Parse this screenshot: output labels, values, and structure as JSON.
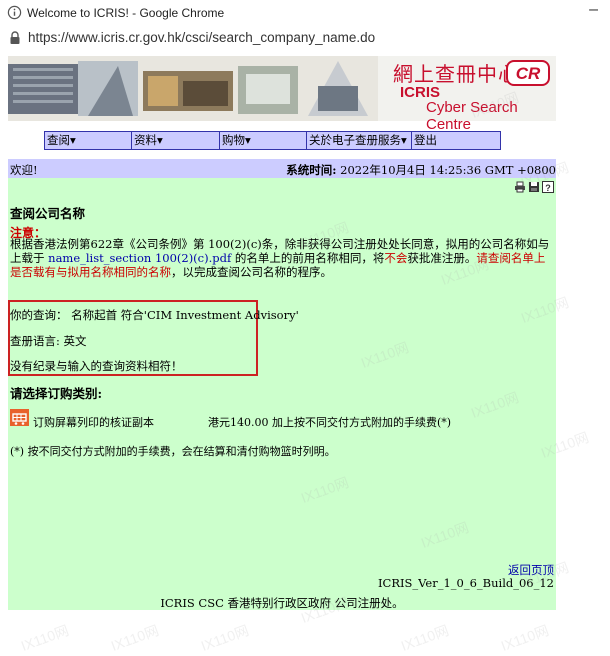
{
  "browser": {
    "window_title": "Welcome to ICRIS! - Google Chrome",
    "minimize_glyph": "–",
    "url": "https://www.icris.cr.gov.hk/csci/search_company_name.do"
  },
  "banner": {
    "chinese_title": "網上查冊中心",
    "icris": "ICRIS",
    "subtitle": "Cyber Search Centre",
    "logo_text": "CR"
  },
  "menu": {
    "items": [
      {
        "label": "查阅▾"
      },
      {
        "label": "资料▾"
      },
      {
        "label": "购物▾"
      },
      {
        "label": "关於电子查册服务▾"
      },
      {
        "label": "登出"
      }
    ]
  },
  "greeting": {
    "welcome": "欢迎!",
    "system_time_label": "系统时间:",
    "system_time_value": "2022年10月4日 14:25:36 GMT +0800"
  },
  "page": {
    "title": "查阅公司名称",
    "note_label": "注意：",
    "note_para_1": "根据香港法例第622章《公司条例》第 100(2)(c)条，除非获得公司注册处处长同意，拟用的公司名称如与上载于 ",
    "note_link": "name_list_section 100(2)(c).pdf",
    "note_para_2": " 的名单上的前用名称相同，将",
    "note_not": "不会",
    "note_para_3": "获批准注册。",
    "note_red": "请查阅名单上是否载有与拟用名称相同的名称",
    "note_para_4": "，以完成查阅公司名称的程序。",
    "query_line": "你的查询： 名称起首 符合'CIM Investment Advisory'",
    "language_line": "查册语言: 英文",
    "no_result_line": "没有纪录与输入的查询资料相符！",
    "order_section_title": "请选择订购类别:",
    "order_item_label": "订购屏幕列印的核证副本",
    "order_item_fee": "港元140.00 加上按不同交付方式附加的手续费(*)",
    "footnote": "(*) 按不同交付方式附加的手续费，会在结算和清付购物篮时列明。",
    "back_link": "返回页顶",
    "version": "ICRIS_Ver_1_0_6_Build_06_12",
    "footer": "ICRIS CSC 香港特别行政区政府 公司注册处。"
  },
  "watermark": "IX110网",
  "colors": {
    "menu_bg": "#ccccff",
    "content_bg": "#ccffcc",
    "accent_red": "#cc0000",
    "link_blue": "#0000aa"
  }
}
